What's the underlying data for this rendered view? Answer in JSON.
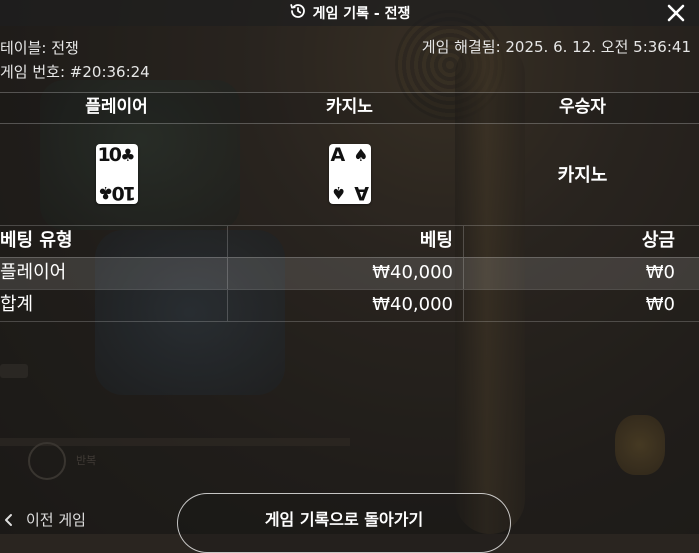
{
  "header": {
    "title": "게임 기록 - 전쟁",
    "history_icon": "history-icon",
    "close_icon": "close-icon"
  },
  "info": {
    "table_label": "테이블: 전쟁",
    "game_number": "게임 번호: #20:36:24",
    "resolved": "게임 해결됨: 2025. 6. 12. 오전 5:36:41"
  },
  "result": {
    "headers": [
      "플레이어",
      "카지노",
      "우승자"
    ],
    "player_card": {
      "rank": "10",
      "suit": "♣"
    },
    "casino_card": {
      "rank": "A",
      "suit": "♠"
    },
    "winner": "카지노"
  },
  "bets": {
    "headers": [
      "베팅 유형",
      "베팅",
      "상금"
    ],
    "rows": [
      {
        "type": "플레이어",
        "bet": "₩40,000",
        "payout": "₩0"
      },
      {
        "type": "합계",
        "bet": "₩40,000",
        "payout": "₩0"
      }
    ]
  },
  "footer": {
    "prev_label": "이전 게임",
    "back_label": "게임 기록으로 돌아가기"
  },
  "background": {
    "ghost_label": "반복"
  }
}
